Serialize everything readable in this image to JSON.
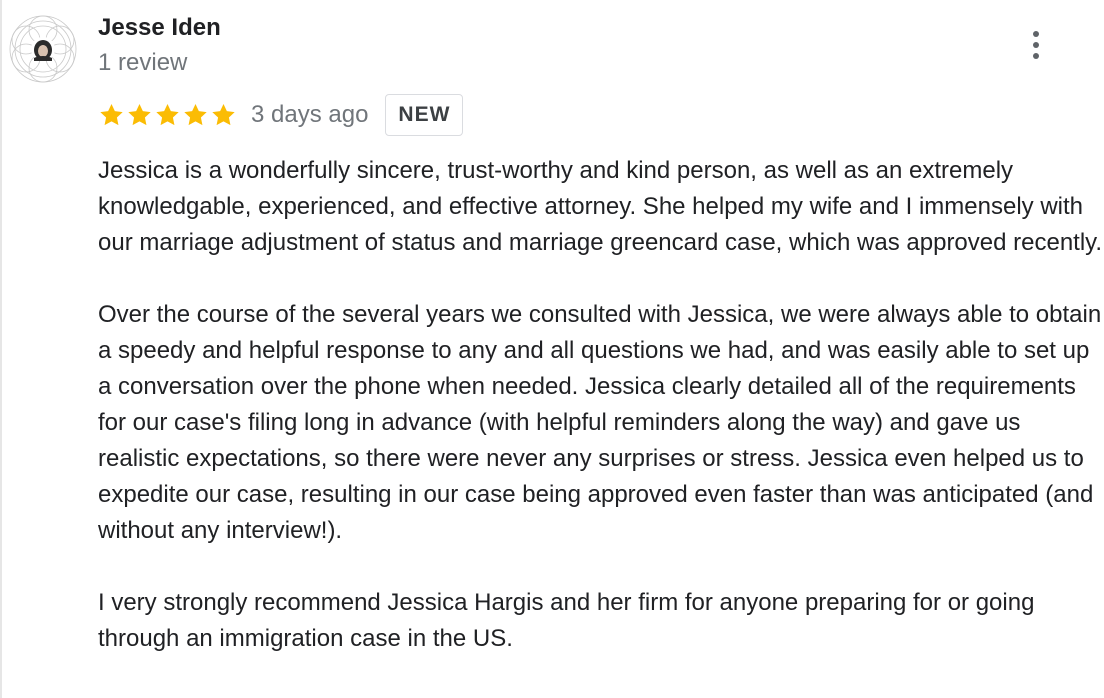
{
  "review": {
    "author": {
      "name": "Jesse Iden",
      "review_count": "1 review",
      "avatar_icon": "profile-avatar-icon"
    },
    "rating": {
      "stars": 5,
      "max": 5,
      "star_color": "#fbbc04"
    },
    "date": "3 days ago",
    "badge": "NEW",
    "more_icon": "more-vert-icon",
    "paragraphs": [
      "Jessica is a wonderfully sincere, trust-worthy and kind person, as well as an extremely knowledgable, experienced, and effective attorney. She helped my wife and I immensely with our marriage adjustment of status and marriage greencard case, which was approved recently.",
      "Over the course of the several years we consulted with Jessica, we were always able to obtain a speedy and helpful response to any and all questions we had, and was easily able to set up a conversation over the phone when needed. Jessica clearly detailed all of the requirements for our case's filing long in advance (with helpful reminders along the way) and gave us realistic expectations, so there were never any surprises or stress. Jessica even helped us to expedite our case, resulting in our case being approved even faster than was anticipated (and without any interview!).",
      "I very strongly recommend Jessica Hargis and her firm for anyone preparing for or going through an immigration case in the US."
    ]
  }
}
